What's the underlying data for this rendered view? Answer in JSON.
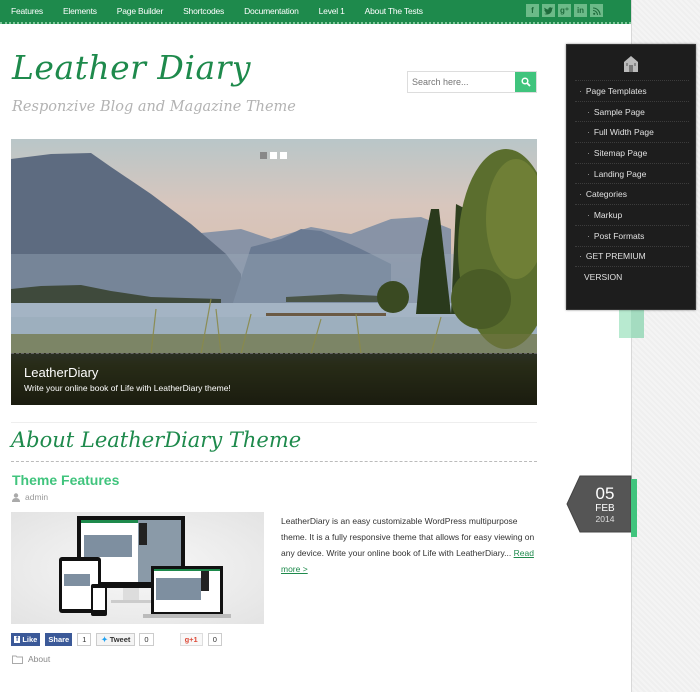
{
  "topnav": {
    "items": [
      "Features",
      "Elements",
      "Page Builder",
      "Shortcodes",
      "Documentation",
      "Level 1",
      "About The Tests"
    ],
    "social": [
      {
        "icon": "facebook-icon",
        "glyph": "f"
      },
      {
        "icon": "twitter-icon",
        "glyph": "t"
      },
      {
        "icon": "google-plus-icon",
        "glyph": "g⁺"
      },
      {
        "icon": "linkedin-icon",
        "glyph": "in"
      },
      {
        "icon": "rss-icon",
        "glyph": "◔"
      }
    ]
  },
  "header": {
    "logo": "Leather Diary",
    "tagline": "Responzive Blog and Magazine Theme"
  },
  "search": {
    "placeholder": "Search here..."
  },
  "slider": {
    "dots": 3,
    "active_dot": 0,
    "caption_title": "LeatherDiary",
    "caption_text": "Write your online book of Life with LeatherDiary theme!"
  },
  "section": {
    "title": "About LeatherDiary Theme"
  },
  "post": {
    "title": "Theme Features",
    "author": "admin",
    "excerpt": "LeatherDiary is an easy customizable WordPress multipurpose theme. It is a fully responsive theme that allows for easy viewing on any device. Write your online book of Life with LeatherDiary... ",
    "read_more": "Read more >",
    "date": {
      "day": "05",
      "month": "FEB",
      "year": "2014"
    },
    "category": "About",
    "share": {
      "fb_like": "Like",
      "fb_share": "Share",
      "fb_count": "1",
      "tweet": "Tweet",
      "tweet_count": "0",
      "gplus": "+1",
      "gplus_count": "0"
    }
  },
  "sidemenu": {
    "items": [
      {
        "label": "Page Templates",
        "level": 1
      },
      {
        "label": "Sample Page",
        "level": 2
      },
      {
        "label": "Full Width Page",
        "level": 2
      },
      {
        "label": "Sitemap Page",
        "level": 2
      },
      {
        "label": "Landing Page",
        "level": 2
      },
      {
        "label": "Categories",
        "level": 1
      },
      {
        "label": "Markup",
        "level": 2
      },
      {
        "label": "Post Formats",
        "level": 2
      },
      {
        "label": "GET PREMIUM",
        "level": 1
      },
      {
        "label": "VERSION",
        "level": 0
      }
    ]
  },
  "colors": {
    "brand_green": "#1e8a4c",
    "accent_green": "#40c47d",
    "menu_dark": "#1d1d1d"
  }
}
